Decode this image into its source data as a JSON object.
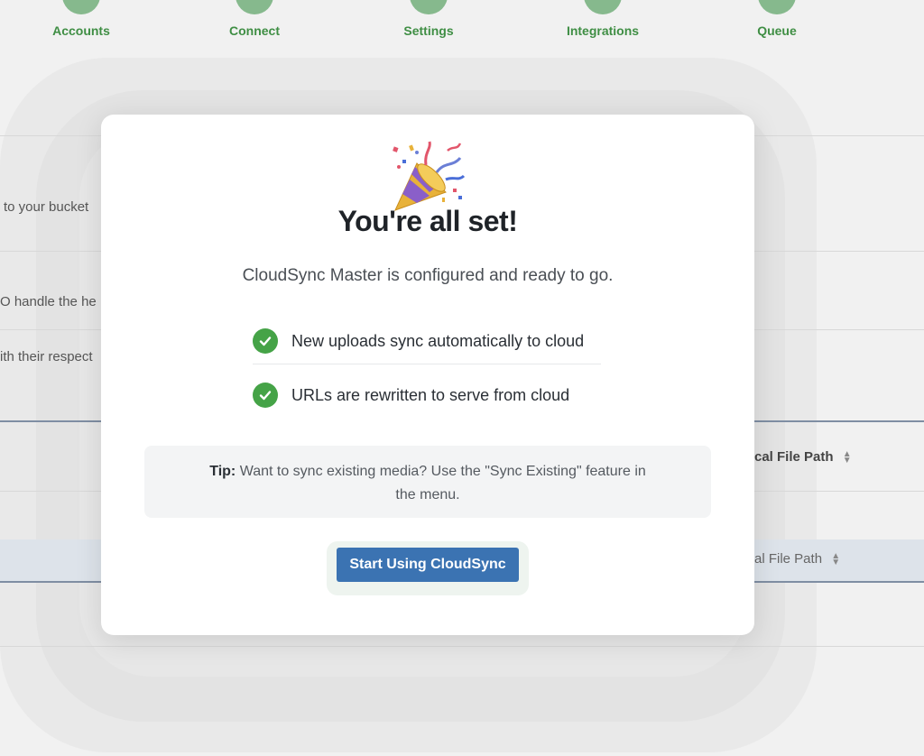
{
  "steps": [
    {
      "label": "Accounts"
    },
    {
      "label": "Connect"
    },
    {
      "label": "Settings"
    },
    {
      "label": "Integrations"
    },
    {
      "label": "Queue"
    }
  ],
  "background": {
    "line1": "to your bucket",
    "line2": "O handle the he",
    "line3": "ith their respect",
    "col_header_1": "cal File Path",
    "col_header_2": "al File Path"
  },
  "modal": {
    "icon": "party-popper-icon",
    "title": "You're all set!",
    "subtitle": "CloudSync Master is configured and ready to go.",
    "features": [
      {
        "text": "New uploads sync automatically to cloud"
      },
      {
        "text": "URLs are rewritten to serve from cloud"
      }
    ],
    "tip": {
      "label": "Tip:",
      "text": "Want to sync existing media? Use the \"Sync Existing\" feature in the menu."
    },
    "button_label": "Start Using CloudSync"
  },
  "colors": {
    "check_green": "#45a347",
    "button_blue": "#3b73b2",
    "step_green": "#3f8e44"
  }
}
